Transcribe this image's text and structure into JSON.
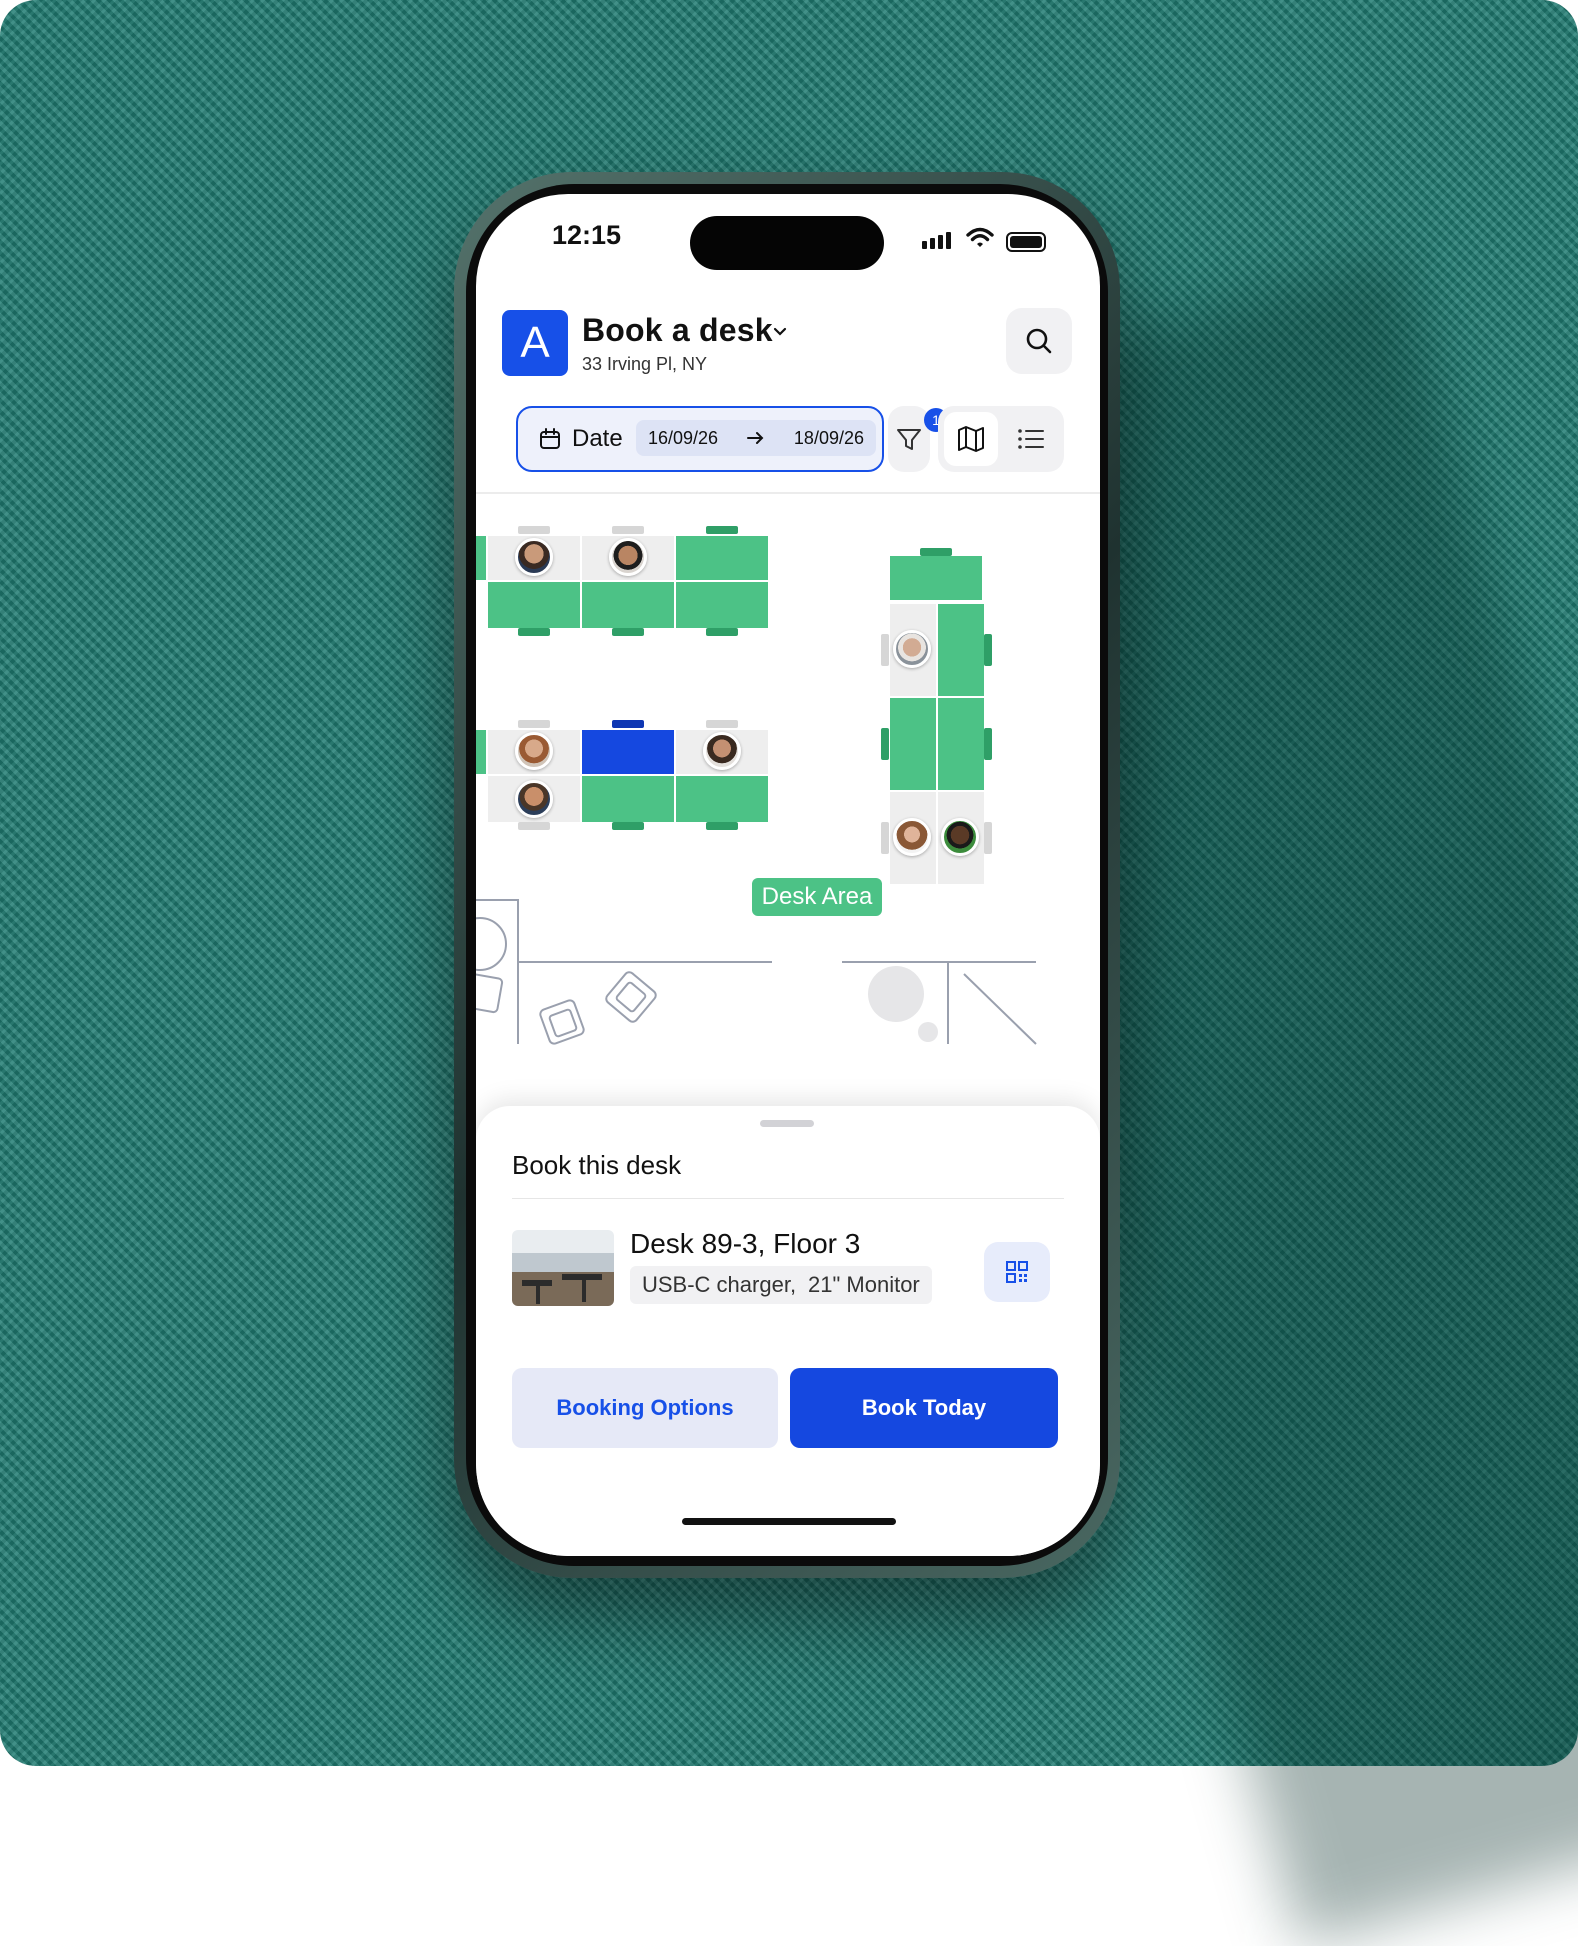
{
  "status_bar": {
    "time": "12:15"
  },
  "header": {
    "logo_letter": "A",
    "title": "Book a desk",
    "subtitle": "33 Irving Pl, NY"
  },
  "toolbar": {
    "date_label": "Date",
    "date_from": "16/09/26",
    "date_to": "18/09/26",
    "filter_badge": "1",
    "views": [
      "map-view",
      "list-view"
    ],
    "active_view": "map-view"
  },
  "floor_map": {
    "area_label": "Desk Area"
  },
  "sheet": {
    "title": "Book this desk",
    "desk_name": "Desk 89-3, Floor 3",
    "amenities": [
      "USB-C charger,",
      "21\" Monitor"
    ],
    "secondary_button": "Booking Options",
    "primary_button": "Book Today"
  },
  "colors": {
    "accent": "#1548E0",
    "available_desk": "#4CC286",
    "selected_desk": "#1548E0",
    "occupied_desk": "#EEEEEE",
    "background": "#1F7C72"
  }
}
